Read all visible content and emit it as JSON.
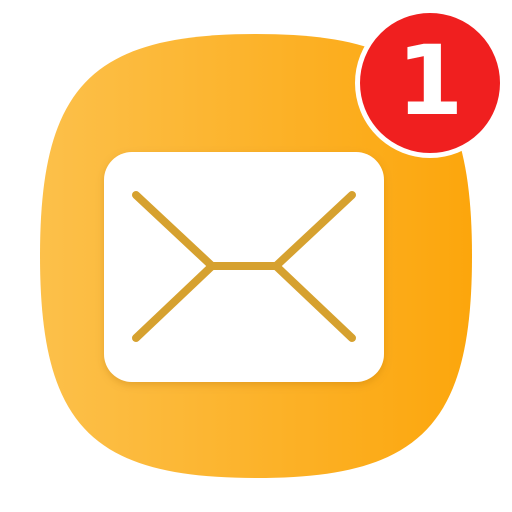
{
  "app": {
    "name_icon": "mail-envelope-icon",
    "colors": {
      "gradient_start": "#FCC04A",
      "gradient_end": "#FCA60C",
      "envelope_fill": "#FFFFFF",
      "envelope_lines": "#D6A12F",
      "badge_background": "#F01F1F",
      "badge_text": "#FFFFFF"
    }
  },
  "badge": {
    "count": "1"
  }
}
